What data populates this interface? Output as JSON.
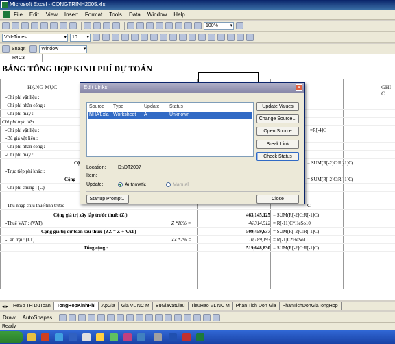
{
  "window": {
    "title": "Microsoft Excel - CONGTRINH2005.xls"
  },
  "menu": [
    "File",
    "Edit",
    "View",
    "Insert",
    "Format",
    "Tools",
    "Data",
    "Window",
    "Help"
  ],
  "toolbar": {
    "zoom": "100%",
    "font_name": "VNI-Times",
    "font_size": "10",
    "snagit_label": "SnagIt",
    "window_label": "Window"
  },
  "namebox": {
    "ref": "R4C3"
  },
  "sheet": {
    "title": "BẢNG TỔNG HỢP KINH PHÍ DỰ TOÁN",
    "col_header_left": "HẠNG MỤC",
    "col_header_right": "GHI C",
    "rows": [
      {
        "label": "-Chi phí vật liệu :"
      },
      {
        "label": "-Chi phí nhân công :"
      },
      {
        "label": "-Chi phí máy :"
      },
      {
        "label": "Chi phí trực tiếp"
      },
      {
        "label": "-Chi phí vật liệu :"
      },
      {
        "label": "-Bù giá vật liệu :"
      },
      {
        "label": "-Chi phí nhân công :"
      },
      {
        "label": "-Chi phí máy :"
      },
      {
        "label": "Cộ"
      },
      {
        "label": "-Trực tiếp phí khác :"
      },
      {
        "label": "Cộng"
      },
      {
        "label": "-Chi phí chung : (C)"
      },
      {
        "label": "-Thu nhập chịu thuế tính trước"
      }
    ],
    "summary": [
      {
        "label": "Cộng giá trị xây lắp trước thuế: (Z )",
        "rate": "",
        "value": "463,145,125",
        "formula": "= SUM(R[-2]C:R[-1]C)"
      },
      {
        "label": "-Thuế VAT : (VAT)",
        "rate": "Z *10% =",
        "value": "46,314,512",
        "formula": "= R[-11]C*HeSo10"
      },
      {
        "label": "Cộng giá trị dự toán sau thuế: (ZZ = Z + VAT)",
        "rate": "",
        "value": "509,459,637",
        "formula": "= SUM(R[-2]C:R[-1]C)"
      },
      {
        "label": "-Lán trại : (LT)",
        "rate": "ZZ *2% =",
        "value": "10,189,193",
        "formula": "= R[-1]C*HeSo11"
      },
      {
        "label": "Tổng cộng :",
        "rate": "",
        "value": "519,648,830",
        "formula": "= SUM(R[-2]C:R[-1]C)"
      }
    ],
    "side_formulas": [
      "= SUM(R[-2]C:R[-1]C)",
      "= SUM(R[-2]C:R[-1]C)",
      "C"
    ]
  },
  "dialog": {
    "title": "Edit Links",
    "columns": [
      "Source",
      "Type",
      "Update",
      "Status"
    ],
    "row": {
      "source": "NHAT.xla",
      "type": "Worksheet",
      "update": "A",
      "status": "Unknown"
    },
    "buttons": [
      "Update Values",
      "Change Source...",
      "Open Source",
      "Break Link",
      "Check Status"
    ],
    "location_label": "Location:",
    "location_value": "D:\\DT2007",
    "item_label": "Item:",
    "update_label": "Update:",
    "automatic": "Automatic",
    "manual": "Manual",
    "startup_button": "Startup Prompt...",
    "close_button": "Close"
  },
  "tabs": [
    "HeSo TH DuToan",
    "TongHopKinhPhi",
    "ApGia",
    "Gia VL NC M",
    "BuGiaVatLieu",
    "TieuHao VL NC M",
    "Phan Tich Don Gia",
    "PhanTichDonGiaTongHop"
  ],
  "active_tab": "TongHopKinhPhi",
  "drawbar": {
    "draw": "Draw",
    "autoshapes": "AutoShapes"
  },
  "status": {
    "text": "Ready"
  }
}
